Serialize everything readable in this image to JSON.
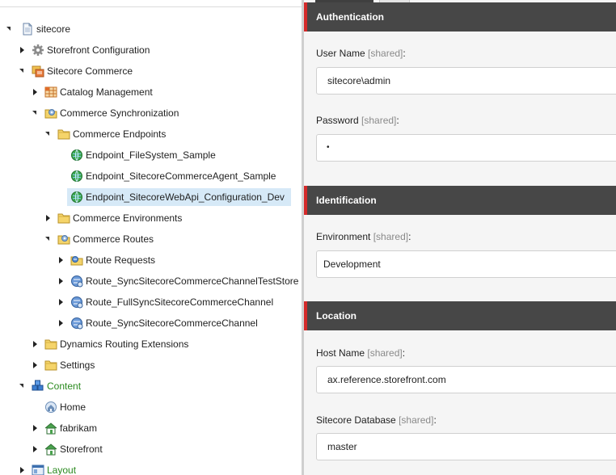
{
  "tree": {
    "nodes": [
      {
        "id": "sitecore",
        "label": "sitecore",
        "icon": "page-icon",
        "expanded": true
      },
      {
        "id": "storefront-configuration",
        "label": "Storefront Configuration",
        "icon": "gear-icon",
        "expanded": false
      },
      {
        "id": "sitecore-commerce",
        "label": "Sitecore Commerce",
        "icon": "commerce-icon",
        "expanded": true
      },
      {
        "id": "catalog-management",
        "label": "Catalog Management",
        "icon": "grid-icon",
        "expanded": false
      },
      {
        "id": "commerce-synchronization",
        "label": "Commerce Synchronization",
        "icon": "sync-folder-icon",
        "expanded": true
      },
      {
        "id": "commerce-endpoints",
        "label": "Commerce Endpoints",
        "icon": "folder-icon",
        "expanded": true
      },
      {
        "id": "endpoint-filesystem",
        "label": "Endpoint_FileSystem_Sample",
        "icon": "endpoint-globe-icon"
      },
      {
        "id": "endpoint-commerceagent",
        "label": "Endpoint_SitecoreCommerceAgent_Sample",
        "icon": "endpoint-globe-icon"
      },
      {
        "id": "endpoint-webapi",
        "label": "Endpoint_SitecoreWebApi_Configuration_Dev",
        "icon": "endpoint-globe-icon",
        "selected": true
      },
      {
        "id": "commerce-environments",
        "label": "Commerce Environments",
        "icon": "folder-icon",
        "expanded": false
      },
      {
        "id": "commerce-routes",
        "label": "Commerce Routes",
        "icon": "sync-folder-icon",
        "expanded": true
      },
      {
        "id": "route-requests",
        "label": "Route Requests",
        "icon": "route-folder-icon",
        "expanded": false
      },
      {
        "id": "route-sync-teststore",
        "label": "Route_SyncSitecoreCommerceChannelTestStore",
        "icon": "route-icon",
        "expanded": false
      },
      {
        "id": "route-fullsync",
        "label": "Route_FullSyncSitecoreCommerceChannel",
        "icon": "route-icon",
        "expanded": false
      },
      {
        "id": "route-sync",
        "label": "Route_SyncSitecoreCommerceChannel",
        "icon": "route-icon",
        "expanded": false
      },
      {
        "id": "dynamics-routing",
        "label": "Dynamics Routing Extensions",
        "icon": "folder-icon",
        "expanded": false
      },
      {
        "id": "settings",
        "label": "Settings",
        "icon": "folder-icon",
        "expanded": false
      },
      {
        "id": "content",
        "label": "Content",
        "icon": "content-cubes-icon",
        "expanded": true,
        "green": true
      },
      {
        "id": "home",
        "label": "Home",
        "icon": "home-icon"
      },
      {
        "id": "fabrikam",
        "label": "fabrikam",
        "icon": "house-icon",
        "expanded": false
      },
      {
        "id": "storefront",
        "label": "Storefront",
        "icon": "house-icon",
        "expanded": false
      },
      {
        "id": "layout",
        "label": "Layout",
        "icon": "layout-icon",
        "expanded": false,
        "green": true
      }
    ]
  },
  "editor": {
    "sections": {
      "authentication": "Authentication",
      "identification": "Identification",
      "location": "Location"
    },
    "shared_tag": "[shared]",
    "fields": {
      "user_name": {
        "label": "User Name",
        "value": "sitecore\\admin"
      },
      "password": {
        "label": "Password",
        "value": "•"
      },
      "environment": {
        "label": "Environment",
        "value": "Development"
      },
      "host_name": {
        "label": "Host Name",
        "value": "ax.reference.storefront.com"
      },
      "sitecore_database": {
        "label": "Sitecore Database",
        "value": "master"
      }
    }
  },
  "colors": {
    "section_header_bg": "#474747",
    "section_accent": "#d42a2a",
    "selected_row_bg": "#d6e9f7",
    "green_label": "#2a8a1f"
  }
}
